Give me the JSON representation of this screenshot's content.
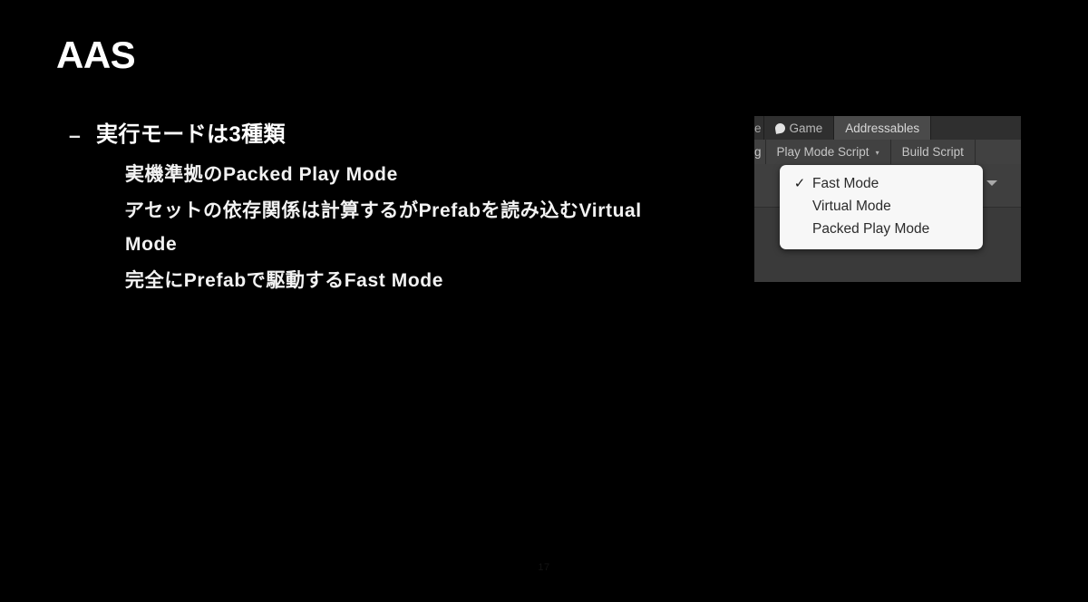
{
  "slide": {
    "title": "AAS",
    "page_number": "17",
    "background_color": "#000000",
    "text_color": "#ffffff"
  },
  "body": {
    "bullets": [
      {
        "dash": "–",
        "text": "実行モードは3種類",
        "children": [
          {
            "dash": "–",
            "text": "実機準拠のPacked Play Mode"
          },
          {
            "dash": "–",
            "text": "アセットの依存関係は計算するがPrefabを読み込むVirtual Mode"
          },
          {
            "dash": "–",
            "text": "完全にPrefabで駆動するFast Mode"
          }
        ]
      }
    ]
  },
  "unity_screenshot": {
    "tabs": [
      {
        "label": "e",
        "icon": "",
        "active": false,
        "clipped": true
      },
      {
        "label": "Game",
        "icon": "game-view-icon",
        "active": false,
        "clipped": false
      },
      {
        "label": "Addressables",
        "icon": "",
        "active": true,
        "clipped": false
      }
    ],
    "toolbar": [
      {
        "label": "g",
        "caret": "",
        "clipped": true
      },
      {
        "label": "Play Mode Script",
        "caret": "▾",
        "clipped": false
      },
      {
        "label": "Build Script",
        "caret": "",
        "clipped": false
      }
    ],
    "dropdown": {
      "items": [
        {
          "label": "Fast Mode",
          "checked": true,
          "check_glyph": "✓"
        },
        {
          "label": "Virtual Mode",
          "checked": false,
          "check_glyph": ""
        },
        {
          "label": "Packed Play Mode",
          "checked": false,
          "check_glyph": ""
        }
      ],
      "background_color": "#f7f7f7",
      "text_color": "#2b2b2b"
    },
    "panel_background": "#3a3a3a"
  }
}
